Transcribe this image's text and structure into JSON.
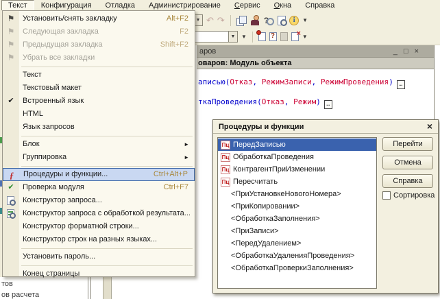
{
  "menubar": {
    "items": [
      {
        "label": "Текст",
        "pressed": true
      },
      {
        "label": "Конфигурация"
      },
      {
        "label": "Отладка"
      },
      {
        "label": "Администрирование"
      },
      {
        "label": "Сервис",
        "underline_first": true
      },
      {
        "label": "Окна",
        "underline_first": true
      },
      {
        "label": "Справка"
      }
    ]
  },
  "text_menu": {
    "items": [
      {
        "label": "Установить/снять закладку",
        "shortcut": "Alt+F2",
        "icon": "bookmark-toggle-icon",
        "glyph": "⚑"
      },
      {
        "label": "Следующая закладка",
        "shortcut": "F2",
        "icon": "bookmark-next-icon",
        "glyph": "⚑",
        "disabled": true
      },
      {
        "label": "Предыдущая закладка",
        "shortcut": "Shift+F2",
        "icon": "bookmark-prev-icon",
        "glyph": "⚑",
        "disabled": true
      },
      {
        "label": "Убрать все закладки",
        "icon": "bookmark-clear-icon",
        "glyph": "⚑",
        "disabled": true
      },
      {
        "separator": true
      },
      {
        "label": "Текст"
      },
      {
        "label": "Текстовый макет"
      },
      {
        "label": "Встроенный язык",
        "checked": true,
        "check_glyph": "✔"
      },
      {
        "label": "HTML"
      },
      {
        "label": "Язык запросов"
      },
      {
        "separator": true
      },
      {
        "label": "Блок",
        "submenu": true,
        "arrow_glyph": "►"
      },
      {
        "label": "Группировка",
        "submenu": true,
        "arrow_glyph": "►"
      },
      {
        "separator": true
      },
      {
        "label": "Процедуры и функции...",
        "shortcut": "Ctrl+Alt+P",
        "highlighted": true,
        "icon": "procedures-icon",
        "glyph": "ƒ"
      },
      {
        "label": "Проверка модуля",
        "shortcut": "Ctrl+F7",
        "icon": "module-check-icon",
        "glyph": "✔"
      },
      {
        "label": "Конструктор запроса...",
        "icon": "query-builder-icon"
      },
      {
        "label": "Конструктор запроса с обработкой результата...",
        "icon": "query-result-builder-icon"
      },
      {
        "label": "Конструктор форматной строки..."
      },
      {
        "label": "Конструктор строк на разных языках..."
      },
      {
        "separator": true
      },
      {
        "label": "Установить пароль..."
      },
      {
        "separator": true
      },
      {
        "label": "Конец страницы"
      }
    ]
  },
  "toolbar": {
    "dropdown_glyph": "▼",
    "undo_glyph": "↶",
    "redo_glyph": "↷",
    "help_glyph": "?",
    "info_glyph": "i",
    "page_q_glyph": "?",
    "page_x_glyph": "×",
    "combo_value": ""
  },
  "editor_window": {
    "title_fragment": "аров",
    "buttons": {
      "minimize": "_",
      "maximize": "□",
      "close": "×"
    },
    "caption_fragment": "оваров: Модуль объекта",
    "collapse_glyph": "…",
    "code_lines": [
      {
        "segments": [
          {
            "text": "аписью(",
            "color": "blue"
          },
          {
            "text": "Отказ",
            "color": "red"
          },
          {
            "text": ",  ",
            "color": "blue"
          },
          {
            "text": "РежимЗаписи",
            "color": "red"
          },
          {
            "text": ",  ",
            "color": "blue"
          },
          {
            "text": "РежимПроведения",
            "color": "red"
          },
          {
            "text": ")",
            "color": "blue"
          }
        ],
        "collapsed": true
      },
      {
        "segments": [
          {
            "text": "ткаПроведения(",
            "color": "blue"
          },
          {
            "text": "Отказ",
            "color": "red"
          },
          {
            "text": ",  ",
            "color": "blue"
          },
          {
            "text": "Режим",
            "color": "red"
          },
          {
            "text": ")",
            "color": "blue"
          }
        ],
        "collapsed": true
      }
    ]
  },
  "dialog": {
    "title": "Процедуры и функции",
    "close_glyph": "×",
    "proc_icon_label": "Пц",
    "list": [
      {
        "label": "ПередЗаписью",
        "icon": true,
        "selected": true
      },
      {
        "label": "ОбработкаПроведения",
        "icon": true
      },
      {
        "label": "КонтрагентПриИзменении",
        "icon": true
      },
      {
        "label": "Пересчитать",
        "icon": true
      },
      {
        "label": "<ПриУстановкеНовогоНомера>"
      },
      {
        "label": "<ПриКопировании>"
      },
      {
        "label": "<ОбработкаЗаполнения>"
      },
      {
        "label": "<ПриЗаписи>"
      },
      {
        "label": "<ПередУдалением>"
      },
      {
        "label": "<ОбработкаУдаленияПроведения>"
      },
      {
        "label": "<ОбработкаПроверкиЗаполнения>"
      }
    ],
    "buttons": {
      "goto": "Перейти",
      "cancel": "Отмена",
      "help": "Справка"
    },
    "sort_checkbox": {
      "label": "Сортировка",
      "checked": false
    }
  },
  "background": {
    "fragment_top": "тов",
    "fragment_bottom": "ов расчета"
  },
  "colors": {
    "selection_blue": "#3a62ae",
    "menu_highlight": "#c9d8f2",
    "code_blue": "#0000cc",
    "code_red": "#cc0033",
    "shortcut_gold": "#a8873b",
    "chrome_cream": "#f2efde"
  }
}
